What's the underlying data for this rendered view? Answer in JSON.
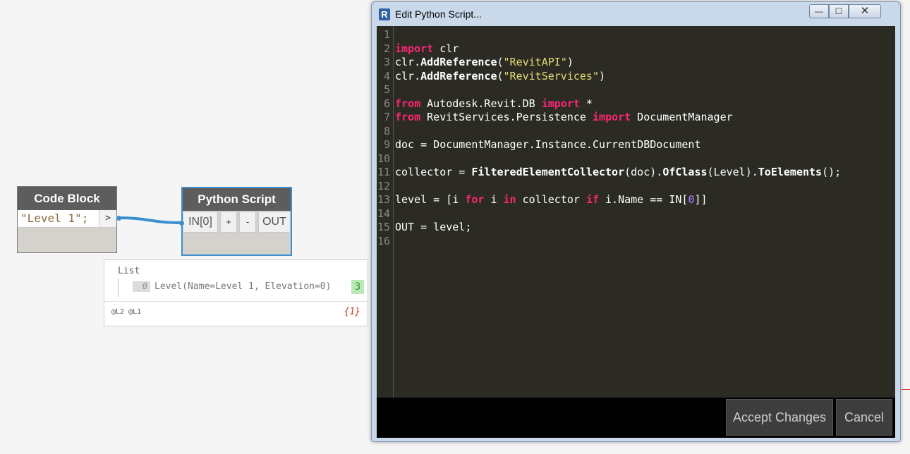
{
  "code_block": {
    "title": "Code Block",
    "code": "\"Level 1\";",
    "out_port": ">"
  },
  "python_node": {
    "title": "Python Script",
    "in_port": "IN[0]",
    "add_port": "+",
    "remove_port": "-",
    "out_port": "OUT"
  },
  "preview": {
    "list_label": "List",
    "item_index": "0",
    "item_value": "Level(Name=Level 1, Elevation=0)",
    "item_badge": "3",
    "levels": "@L2 @L1",
    "count": "{1}"
  },
  "editor": {
    "app_icon": "R",
    "window_title": "Edit Python Script...",
    "minimize_glyph": "—",
    "maximize_glyph": "☐",
    "close_glyph": "✕",
    "accept_label": "Accept Changes",
    "cancel_label": "Cancel",
    "code_lines": [
      {
        "n": "1",
        "parts": []
      },
      {
        "n": "2",
        "parts": [
          {
            "t": "import",
            "c": "kw"
          },
          {
            "t": " clr",
            "c": ""
          }
        ]
      },
      {
        "n": "3",
        "parts": [
          {
            "t": "clr.",
            "c": ""
          },
          {
            "t": "AddReference",
            "c": "fn"
          },
          {
            "t": "(",
            "c": ""
          },
          {
            "t": "\"RevitAPI\"",
            "c": "str"
          },
          {
            "t": ")",
            "c": ""
          }
        ]
      },
      {
        "n": "4",
        "parts": [
          {
            "t": "clr.",
            "c": ""
          },
          {
            "t": "AddReference",
            "c": "fn"
          },
          {
            "t": "(",
            "c": ""
          },
          {
            "t": "\"RevitServices\"",
            "c": "str"
          },
          {
            "t": ")",
            "c": ""
          }
        ]
      },
      {
        "n": "5",
        "parts": []
      },
      {
        "n": "6",
        "parts": [
          {
            "t": "from",
            "c": "kw"
          },
          {
            "t": " Autodesk.Revit.DB ",
            "c": ""
          },
          {
            "t": "import",
            "c": "kw"
          },
          {
            "t": " *",
            "c": ""
          }
        ]
      },
      {
        "n": "7",
        "parts": [
          {
            "t": "from",
            "c": "kw"
          },
          {
            "t": " RevitServices.Persistence ",
            "c": ""
          },
          {
            "t": "import",
            "c": "kw"
          },
          {
            "t": " DocumentManager",
            "c": ""
          }
        ]
      },
      {
        "n": "8",
        "parts": []
      },
      {
        "n": "9",
        "parts": [
          {
            "t": "doc = DocumentManager.Instance.CurrentDBDocument",
            "c": ""
          }
        ]
      },
      {
        "n": "10",
        "parts": []
      },
      {
        "n": "11",
        "parts": [
          {
            "t": "collector = ",
            "c": ""
          },
          {
            "t": "FilteredElementCollector",
            "c": "fn"
          },
          {
            "t": "(doc).",
            "c": ""
          },
          {
            "t": "OfClass",
            "c": "fn"
          },
          {
            "t": "(Level).",
            "c": ""
          },
          {
            "t": "ToElements",
            "c": "fn"
          },
          {
            "t": "();",
            "c": ""
          }
        ]
      },
      {
        "n": "12",
        "parts": []
      },
      {
        "n": "13",
        "parts": [
          {
            "t": "level = [i ",
            "c": ""
          },
          {
            "t": "for",
            "c": "kw"
          },
          {
            "t": " i ",
            "c": ""
          },
          {
            "t": "in",
            "c": "kw"
          },
          {
            "t": " collector ",
            "c": ""
          },
          {
            "t": "if",
            "c": "kw"
          },
          {
            "t": " i.Name == IN[",
            "c": ""
          },
          {
            "t": "0",
            "c": "num"
          },
          {
            "t": "]]",
            "c": ""
          }
        ]
      },
      {
        "n": "14",
        "parts": []
      },
      {
        "n": "15",
        "parts": [
          {
            "t": "OUT = level;",
            "c": ""
          }
        ]
      },
      {
        "n": "16",
        "parts": []
      }
    ]
  }
}
